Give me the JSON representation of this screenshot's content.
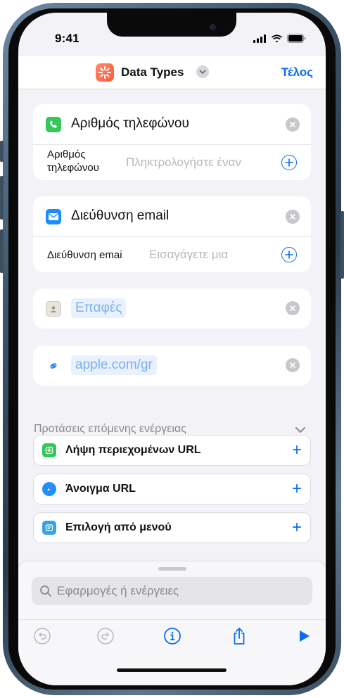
{
  "status_bar": {
    "time": "9:41"
  },
  "nav": {
    "title": "Data Types",
    "done_label": "Τέλος"
  },
  "cards": {
    "phone": {
      "title": "Αριθμός τηλεφώνου",
      "field_label_line1": "Αριθμός",
      "field_label_line2": "τηλεφώνου",
      "field_placeholder": "Πληκτρολογήστε έναν"
    },
    "email": {
      "title": "Διεύθυνση email",
      "field_label": "Διεύθυνση emai",
      "field_placeholder": "Εισαγάγετε μια"
    },
    "contacts": {
      "token": "Επαφές"
    },
    "url": {
      "token": "apple.com/gr"
    }
  },
  "suggestions": {
    "title": "Προτάσεις επόμενης ενέργειας",
    "items": [
      {
        "label": "Λήψη περιεχομένων URL",
        "icon": "download-icon",
        "color": "#34c759"
      },
      {
        "label": "Άνοιγμα URL",
        "icon": "safari-icon",
        "color": "#1e90ff"
      },
      {
        "label": "Επιλογή από μενού",
        "icon": "menu-icon",
        "color": "#3aa0e8"
      }
    ]
  },
  "search": {
    "placeholder": "Εφαρμογές ή ενέργειες"
  },
  "colors": {
    "accent": "#0a6cf0",
    "background": "#f2f2f7"
  }
}
